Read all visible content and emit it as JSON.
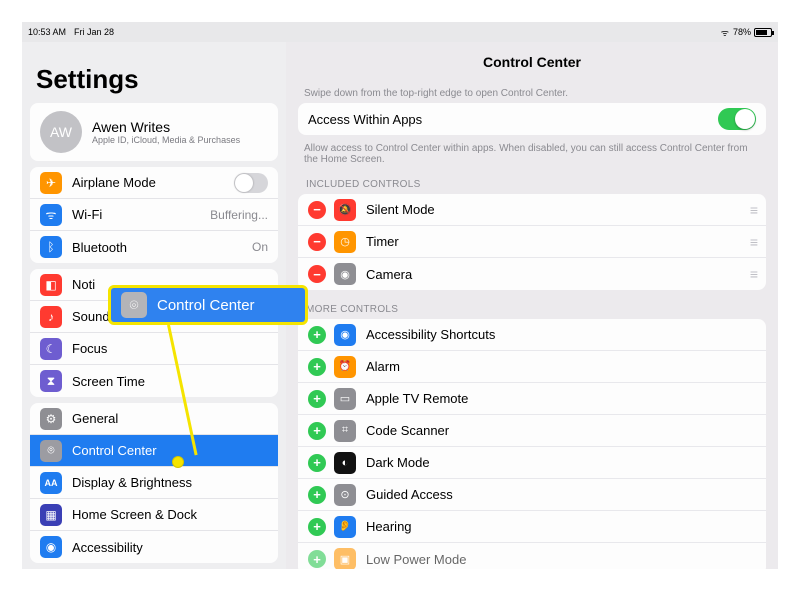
{
  "statusbar": {
    "time": "10:53 AM",
    "date": "Fri Jan 28",
    "battery_pct": "78%"
  },
  "sidebar": {
    "title": "Settings",
    "profile": {
      "initials": "AW",
      "name": "Awen Writes",
      "sub": "Apple ID, iCloud, Media & Purchases"
    },
    "group1": [
      {
        "label": "Airplane Mode",
        "icon": "airplane",
        "value": "",
        "toggle": "off",
        "color": "#ff9500"
      },
      {
        "label": "Wi-Fi",
        "icon": "wifi",
        "value": "Buffering...",
        "color": "#1f7cf0"
      },
      {
        "label": "Bluetooth",
        "icon": "bluetooth",
        "value": "On",
        "color": "#1f7cf0"
      }
    ],
    "group2": [
      {
        "label": "Notifications",
        "short": "Noti",
        "icon": "bell",
        "color": "#ff3a30"
      },
      {
        "label": "Sounds",
        "icon": "sound",
        "color": "#ff3a30"
      },
      {
        "label": "Focus",
        "icon": "moon",
        "color": "#6e5dd0"
      },
      {
        "label": "Screen Time",
        "icon": "hourglass",
        "color": "#6e5dd0"
      }
    ],
    "group3": [
      {
        "label": "General",
        "icon": "gear",
        "color": "#8e8e93"
      },
      {
        "label": "Control Center",
        "icon": "control-center",
        "color": "#8e8e93",
        "selected": true
      },
      {
        "label": "Display & Brightness",
        "icon": "display",
        "color": "#1f7cf0"
      },
      {
        "label": "Home Screen & Dock",
        "icon": "home",
        "color": "#3a3fb5"
      },
      {
        "label": "Accessibility",
        "icon": "accessibility",
        "color": "#1f7cf0"
      }
    ]
  },
  "callout": {
    "label": "Control Center"
  },
  "detail": {
    "title": "Control Center",
    "swipe_hint": "Swipe down from the top-right edge to open Control Center.",
    "access_row": {
      "label": "Access Within Apps",
      "toggle": "on"
    },
    "access_hint": "Allow access to Control Center within apps. When disabled, you can still access Control Center from the Home Screen.",
    "included_label": "Included Controls",
    "included": [
      {
        "label": "Silent Mode",
        "icon": "silent",
        "color": "#ff3a30"
      },
      {
        "label": "Timer",
        "icon": "timer",
        "color": "#ff9500"
      },
      {
        "label": "Camera",
        "icon": "camera",
        "color": "#8e8e93"
      }
    ],
    "more_label": "More Controls",
    "more": [
      {
        "label": "Accessibility Shortcuts",
        "icon": "accessibility",
        "color": "#1f7cf0"
      },
      {
        "label": "Alarm",
        "icon": "alarm",
        "color": "#ff9500"
      },
      {
        "label": "Apple TV Remote",
        "icon": "tv",
        "color": "#8e8e93"
      },
      {
        "label": "Code Scanner",
        "icon": "scan",
        "color": "#8e8e93"
      },
      {
        "label": "Dark Mode",
        "icon": "dark",
        "color": "#111"
      },
      {
        "label": "Guided Access",
        "icon": "guide",
        "color": "#8e8e93"
      },
      {
        "label": "Hearing",
        "icon": "hear",
        "color": "#1f7cf0"
      },
      {
        "label": "Low Power Mode",
        "icon": "low",
        "color": "#ff9500"
      }
    ]
  }
}
